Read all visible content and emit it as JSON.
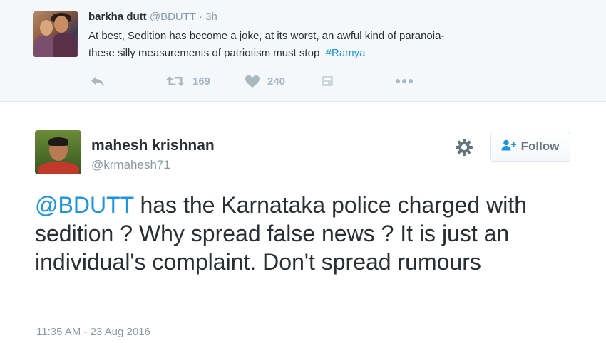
{
  "parent_tweet": {
    "author_name": "barkha dutt",
    "author_handle": "@BDUTT",
    "separator": "·",
    "time": "3h",
    "text_line1": "At best, Sedition has become a joke, at its worst, an awful kind of paranoia-",
    "text_line2": "these silly measurements of patriotism must stop",
    "hashtag": "#Ramya",
    "actions": {
      "reply_icon": "reply-icon",
      "retweet_icon": "retweet-icon",
      "retweet_count": "169",
      "like_icon": "heart-icon",
      "like_count": "240",
      "dm_icon": "direct-message-icon",
      "more_icon": "more-dots-icon"
    }
  },
  "tweet": {
    "author_name": "mahesh krishnan",
    "author_handle": "@krmahesh71",
    "settings_icon": "gear-icon",
    "follow_label": "Follow",
    "follow_icon": "follow-user-icon",
    "mention": "@BDUTT",
    "text": " has the Karnataka police charged with sedition ? Why spread false news ? It is just an individual's complaint. Don't spread rumours",
    "timestamp": "11:35 AM - 23 Aug 2016"
  },
  "colors": {
    "link": "#1b95e0",
    "secondary_text": "#8899a6",
    "action_icon": "#aab8c2",
    "parent_background": "#f5f8fa"
  }
}
